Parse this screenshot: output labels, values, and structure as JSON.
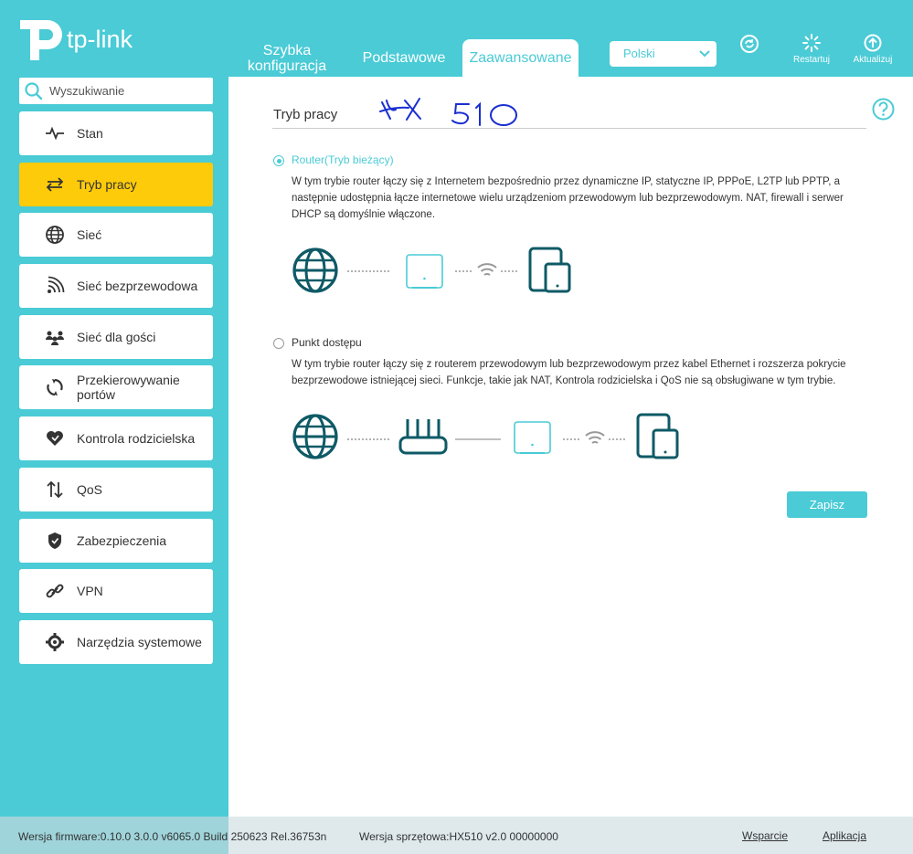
{
  "header": {
    "brand": "tp-link",
    "tabs": [
      {
        "label": "Szybka konfiguracja"
      },
      {
        "label": "Podstawowe"
      },
      {
        "label": "Zaawansowane"
      }
    ],
    "language": "Polski",
    "restart_label": "Restartuj",
    "update_label": "Aktualizuj"
  },
  "sidebar": {
    "search_placeholder": "Wyszukiwanie",
    "items": [
      {
        "label": "Stan",
        "icon": "pulse-icon"
      },
      {
        "label": "Tryb pracy",
        "icon": "swap-icon",
        "active": true
      },
      {
        "label": "Sieć",
        "icon": "globe-icon"
      },
      {
        "label": "Sieć bezprzewodowa",
        "icon": "wireless-icon"
      },
      {
        "label": "Sieć dla gości",
        "icon": "guests-icon"
      },
      {
        "label": "Przekierowywanie portów",
        "icon": "port-forward-icon"
      },
      {
        "label": "Kontrola rodzicielska",
        "icon": "heart-icon"
      },
      {
        "label": "QoS",
        "icon": "updown-arrows-icon"
      },
      {
        "label": "Zabezpieczenia",
        "icon": "shield-icon"
      },
      {
        "label": "VPN",
        "icon": "link-icon"
      },
      {
        "label": "Narzędzia systemowe",
        "icon": "gear-icon"
      }
    ]
  },
  "main": {
    "title": "Tryb pracy",
    "handwritten_note": "HX 510",
    "options": [
      {
        "label": "Router(Tryb bieżący)",
        "selected": true,
        "description": "W tym trybie router łączy się z Internetem bezpośrednio przez dynamiczne IP, statyczne IP, PPPoE, L2TP lub PPTP, a następnie udostępnia łącze internetowe wielu urządzeniom przewodowym lub bezprzewodowym. NAT, firewall i serwer DHCP są domyślnie włączone."
      },
      {
        "label": "Punkt dostępu",
        "selected": false,
        "description": "W tym trybie router łączy się z routerem przewodowym lub bezprzewodowym przez kabel Ethernet i rozszerza pokrycie bezprzewodowe istniejącej sieci. Funkcje, takie jak NAT, Kontrola rodzicielska i QoS nie są obsługiwane w tym trybie."
      }
    ],
    "save_label": "Zapisz"
  },
  "footer": {
    "firmware": "Wersja firmware:0.10.0 3.0.0 v6065.0 Build 250623 Rel.36753n",
    "hardware": "Wersja sprzętowa:HX510 v2.0 00000000",
    "support_link": "Wsparcie",
    "app_link": "Aplikacja"
  },
  "colors": {
    "accent": "#4acbd6",
    "active_menu": "#fdcb0a",
    "diagram_dark": "#0e5a66"
  }
}
